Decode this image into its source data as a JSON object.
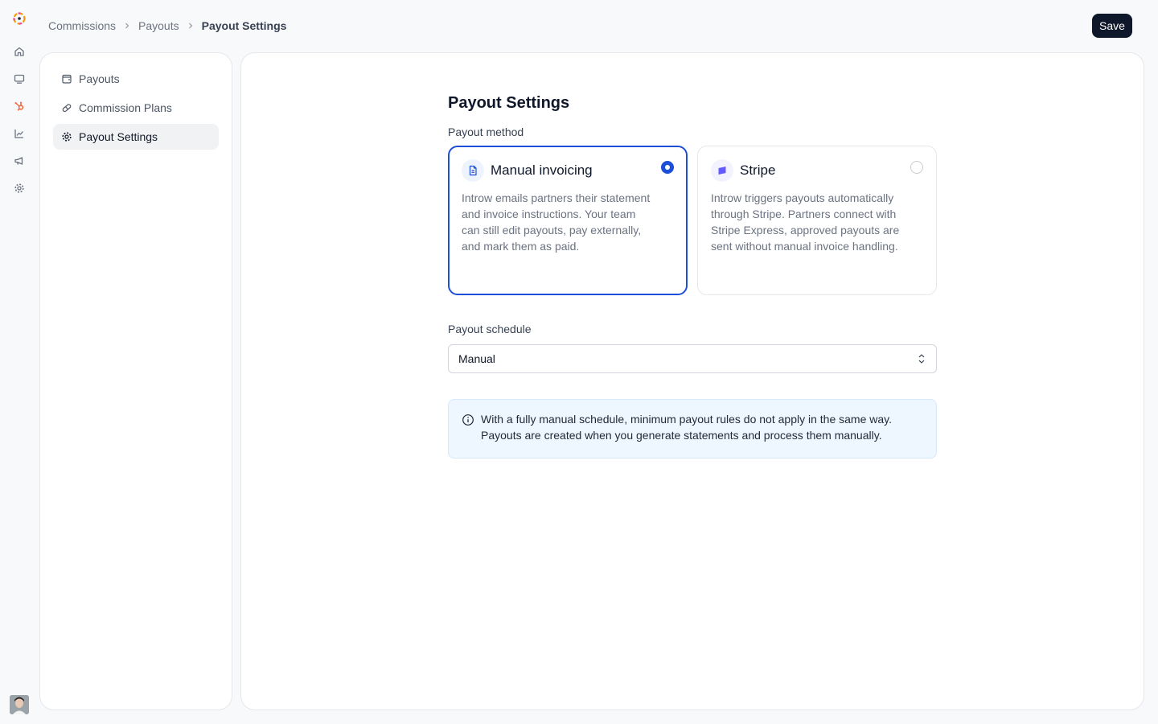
{
  "app": {
    "logo": "app-logo-icon"
  },
  "rail": {
    "items": [
      {
        "icon": "home-icon"
      },
      {
        "icon": "monitor-icon"
      },
      {
        "icon": "hubspot-icon"
      },
      {
        "icon": "chart-icon"
      },
      {
        "icon": "megaphone-icon"
      },
      {
        "icon": "gear-icon"
      }
    ],
    "avatar": "user-avatar"
  },
  "breadcrumb": {
    "items": [
      "Commissions",
      "Payouts"
    ],
    "current": "Payout Settings"
  },
  "header": {
    "save_label": "Save"
  },
  "sub_nav": {
    "items": [
      {
        "label": "Payouts",
        "icon": "wallet-icon"
      },
      {
        "label": "Commission Plans",
        "icon": "pill-icon"
      },
      {
        "label": "Payout Settings",
        "icon": "gear-icon",
        "active": true
      }
    ]
  },
  "main": {
    "title": "Payout Settings",
    "payout_method": {
      "label": "Payout method",
      "options": [
        {
          "title": "Manual invoicing",
          "description": "Introw emails partners their statement and invoice instructions. Your team can still edit payouts, pay externally, and mark them as paid.",
          "icon": "document-icon",
          "selected": true
        },
        {
          "title": "Stripe",
          "description": "Introw triggers payouts automatically through Stripe. Partners connect with Stripe Express, approved payouts are sent without manual invoice handling.",
          "icon": "stripe-icon",
          "selected": false
        }
      ]
    },
    "payout_schedule": {
      "label": "Payout schedule",
      "value": "Manual"
    },
    "info": {
      "text": "With a fully manual schedule, minimum payout rules do not apply in the same way. Payouts are created when you generate statements and process them manually."
    }
  },
  "colors": {
    "accent": "#1d4ed8",
    "save_button": "#0f172a",
    "hubspot": "#f4623a",
    "info_bg": "#eef6ff",
    "stripe": "#635bff"
  }
}
